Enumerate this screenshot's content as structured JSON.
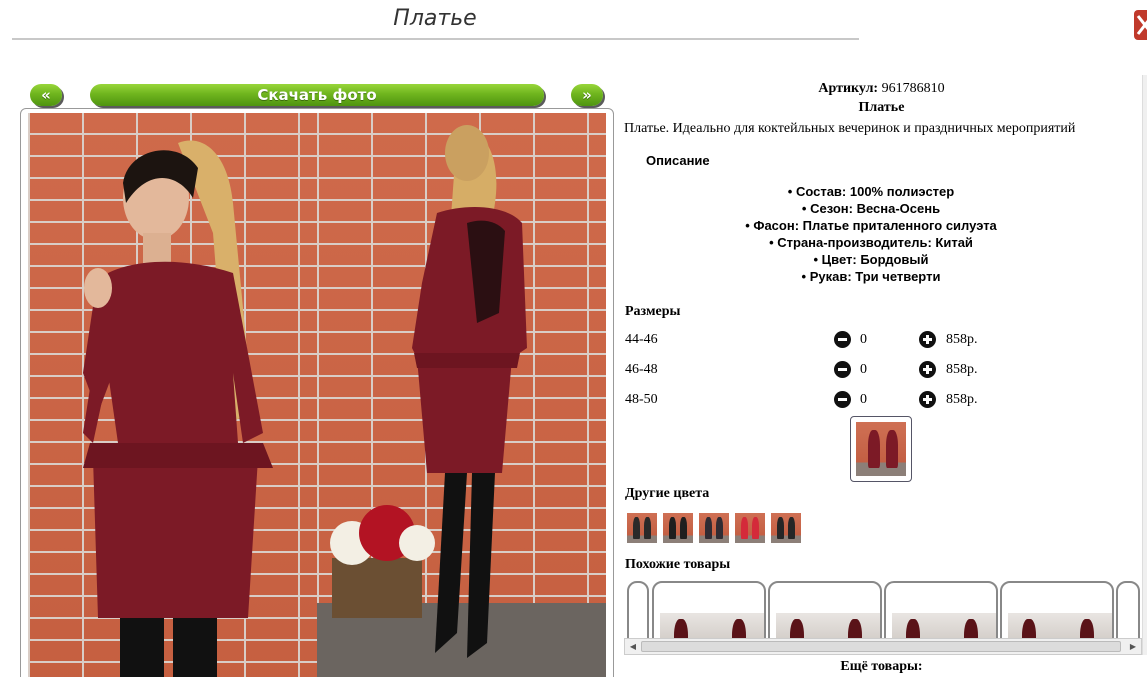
{
  "header": {
    "title": "Платье"
  },
  "gallery": {
    "prev_label": "«",
    "next_label": "»",
    "download_label": "Скачать фото"
  },
  "product": {
    "article_label": "Артикул:",
    "article_value": "961786810",
    "name": "Платье",
    "description": "Платье. Идеально для коктейльных вечеринок и праздничных мероприятий"
  },
  "details": {
    "heading": "Описание",
    "attributes": [
      "Состав: 100% полиэстер",
      "Сезон: Весна-Осень",
      "Фасон: Платье приталенного силуэта",
      "Страна-производитель: Китай",
      "Цвет: Бордовый",
      "Рукав: Три четверти"
    ]
  },
  "sizes": {
    "heading": "Размеры",
    "rows": [
      {
        "size": "44-46",
        "qty": "0",
        "price": "858р."
      },
      {
        "size": "46-48",
        "qty": "0",
        "price": "858р."
      },
      {
        "size": "48-50",
        "qty": "0",
        "price": "858р."
      }
    ]
  },
  "other_colors": {
    "heading": "Другие цвета",
    "count": 5
  },
  "similar": {
    "heading": "Похожие товары"
  },
  "more": {
    "label": "Ещё товары:"
  },
  "colors": {
    "accent_green": "#6fb51e",
    "dress": "#7c1a26",
    "close_red": "#c0392b"
  }
}
